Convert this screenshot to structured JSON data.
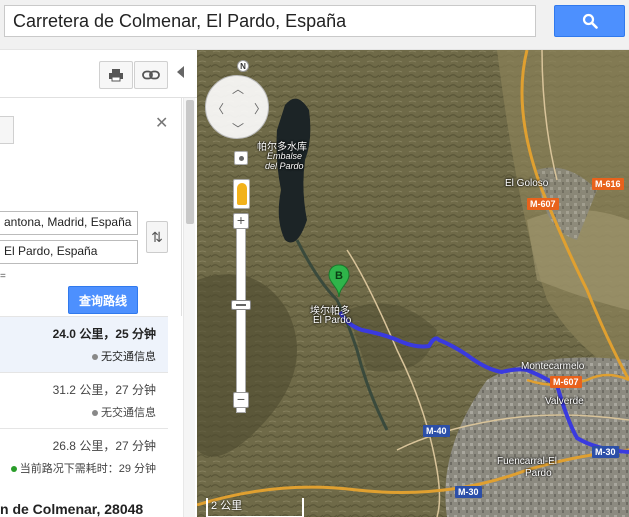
{
  "search": {
    "value": "Carretera de Colmenar, El Pardo, España"
  },
  "directions": {
    "start_value": "antona, Madrid, España",
    "end_value": "El Pardo, España",
    "find_route_label": "查询路线",
    "close_label": "✕",
    "swap_label": "⇅",
    "grip_text": "="
  },
  "routes": [
    {
      "distance_time": "24.0 公里，25 分钟",
      "traffic": "无交通信息",
      "status_color": "#888888",
      "selected": true
    },
    {
      "distance_time": "31.2 公里，27 分钟",
      "traffic": "无交通信息",
      "status_color": "#888888",
      "selected": false
    },
    {
      "distance_time": "26.8 公里，27 分钟",
      "traffic": "当前路况下需耗时：29 分钟",
      "status_color": "#2a9d2a",
      "selected": false
    }
  ],
  "destination_address": "n de Colmenar, 28048",
  "map": {
    "labels": {
      "reservoir_cn": "帕尔多水库",
      "reservoir_es_1": "Embalse",
      "reservoir_es_2": "del Pardo",
      "el_goloso": "El Goloso",
      "town_cn": "埃尔帕多",
      "town_es": "El Pardo",
      "montecarmelo": "Montecarmelo",
      "valverde": "Valverde",
      "fuencarral_1": "Fuencarral-El",
      "fuencarral_2": "Pardo"
    },
    "roads": {
      "m616": "M-616",
      "m607_top": "M-607",
      "m607_mid": "M-607",
      "m40": "M-40",
      "m30_left": "M-30",
      "m30_right": "M-30"
    },
    "marker_label": "B",
    "compass_label": "N",
    "scale": "2 公里",
    "route_color": "#3a3adf",
    "accent_color": "#4d90fe"
  }
}
